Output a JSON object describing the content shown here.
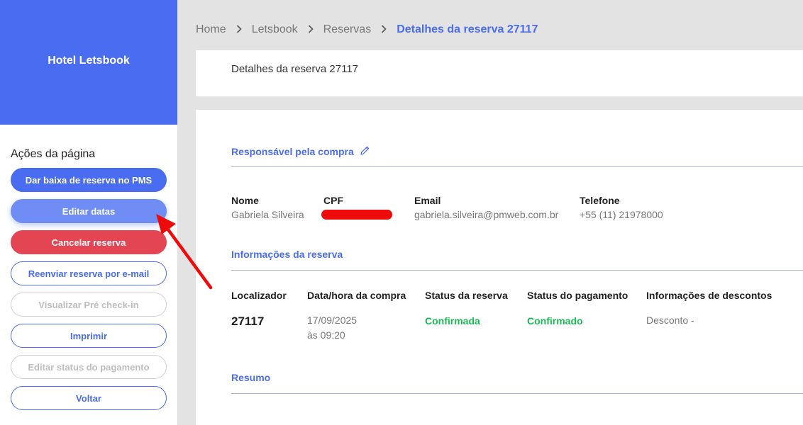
{
  "sidebar": {
    "brand": "Hotel Letsbook",
    "actions_title": "Ações da página",
    "buttons": {
      "dar_baixa": "Dar baixa de reserva no PMS",
      "editar_datas": "Editar datas",
      "cancelar": "Cancelar reserva",
      "reenviar": "Reenviar reserva por e-mail",
      "pre_checkin": "Visualizar Pré check-in",
      "imprimir": "Imprimir",
      "editar_status": "Editar status do pagamento",
      "voltar": "Voltar"
    }
  },
  "breadcrumb": {
    "items": [
      "Home",
      "Letsbook",
      "Reservas"
    ],
    "current": "Detalhes da reserva 27117"
  },
  "header": {
    "title": "Detalhes da reserva 27117"
  },
  "buyer": {
    "section_title": "Responsável pela compra",
    "name_label": "Nome",
    "name_value": "Gabriela Silveira",
    "cpf_label": "CPF",
    "email_label": "Email",
    "email_value": "gabriela.silveira@pmweb.com.br",
    "phone_label": "Telefone",
    "phone_value": "+55 (11) 21978000"
  },
  "reservation": {
    "section_title": "Informações da reserva",
    "columns": {
      "locator": "Localizador",
      "purchase_datetime": "Data/hora da compra",
      "reservation_status": "Status da reserva",
      "payment_status": "Status do pagamento",
      "discount_info": "Informações de descontos"
    },
    "locator": "27117",
    "purchase_date": "17/09/2025",
    "purchase_time": "às 09:20",
    "reservation_status": "Confirmada",
    "payment_status": "Confirmado",
    "discount": "Desconto -"
  },
  "summary": {
    "section_title": "Resumo"
  },
  "colors": {
    "primary": "#4a6cf0",
    "danger": "#e44552",
    "success": "#1bb954",
    "redaction": "#ee0b0b",
    "annotation_arrow": "#ee0b0b"
  },
  "icons": {
    "edit": "pencil-icon",
    "breadcrumb_separator": "chevron-right-icon"
  }
}
